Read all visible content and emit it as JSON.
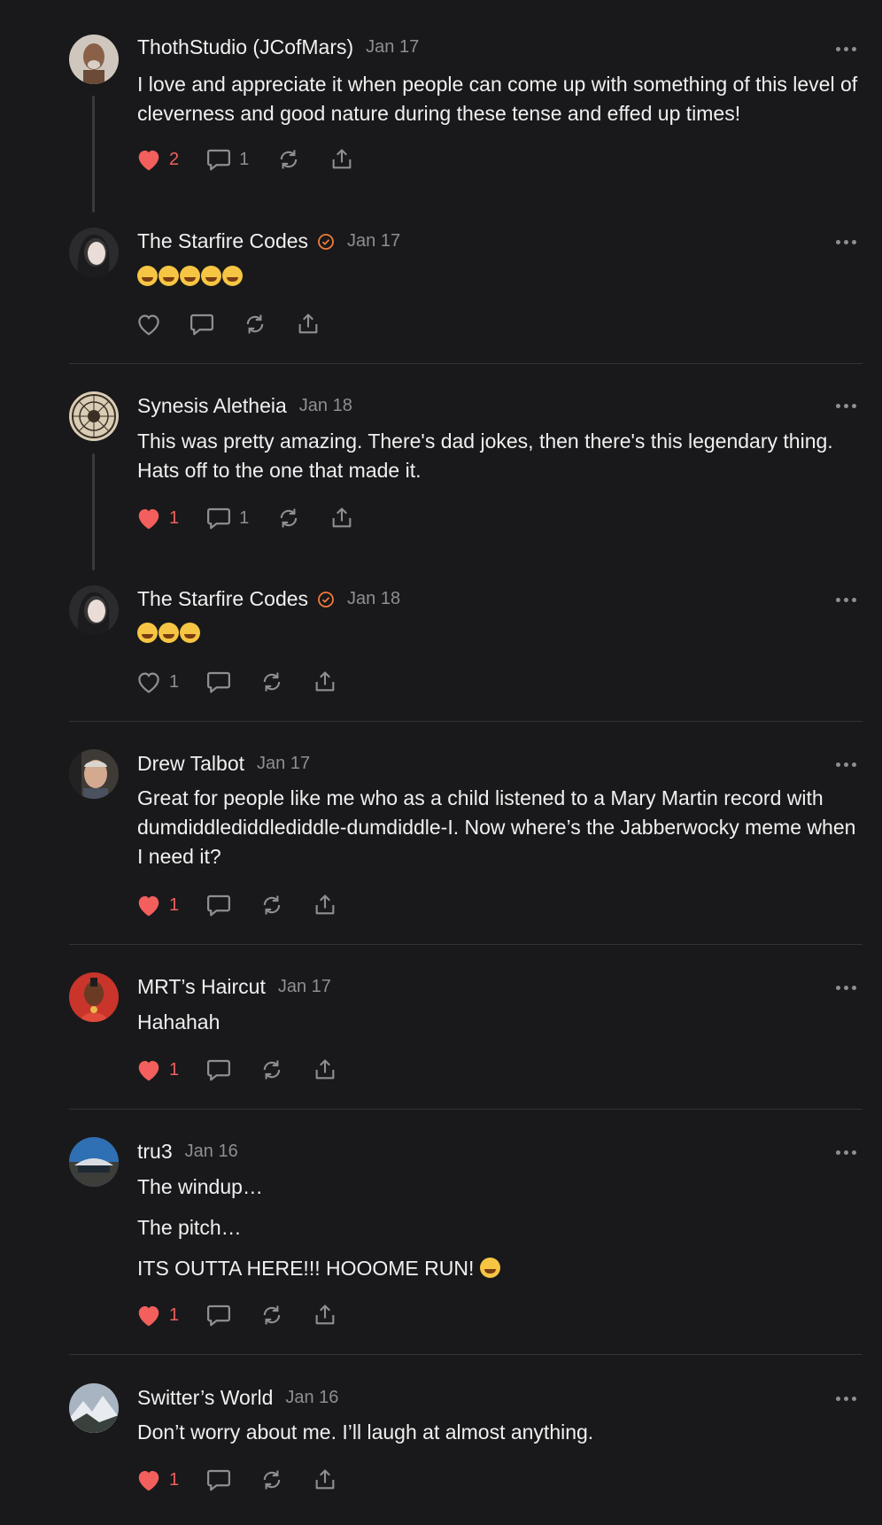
{
  "colors": {
    "background": "#19191b",
    "text": "#f0f0f0",
    "muted": "#8e8e93",
    "like": "#f25f5c",
    "verified": "#f07c3a",
    "divider": "#333336"
  },
  "comments": [
    {
      "author": "ThothStudio (JCofMars)",
      "date": "Jan 17",
      "text": [
        "I love and appreciate it when people can come up with something of this level of cleverness and good nature during these tense and effed up times!"
      ],
      "likes": "2",
      "replies": "1",
      "liked": true
    },
    {
      "author": "The Starfire Codes",
      "verified": true,
      "date": "Jan 17",
      "emoji_count": 5,
      "emoji_name": "rolling-on-floor-laughing",
      "likes": "",
      "replies": "",
      "liked": false
    },
    {
      "author": "Synesis Aletheia",
      "date": "Jan 18",
      "text": [
        "This was pretty amazing. There's dad jokes, then there's this legendary thing. Hats off to the one that made it."
      ],
      "likes": "1",
      "replies": "1",
      "liked": true
    },
    {
      "author": "The Starfire Codes",
      "verified": true,
      "date": "Jan 18",
      "emoji_count": 3,
      "emoji_name": "rolling-on-floor-laughing",
      "likes": "1",
      "replies": "",
      "liked": false
    },
    {
      "author": "Drew Talbot",
      "date": "Jan 17",
      "text": [
        "Great for people like me who as a child listened to a Mary Martin record with dumdiddlediddlediddle-dumdiddle-I. Now where’s the Jabberwocky meme when I need it?"
      ],
      "likes": "1",
      "replies": "",
      "liked": true
    },
    {
      "author": "MRT’s Haircut",
      "date": "Jan 17",
      "text": [
        "Hahahah"
      ],
      "likes": "1",
      "replies": "",
      "liked": true
    },
    {
      "author": "tru3",
      "date": "Jan 16",
      "text": [
        "The windup…",
        "The pitch…",
        "ITS OUTTA HERE!!! HOOOME RUN!"
      ],
      "trailing_emoji": "grinning-face",
      "likes": "1",
      "replies": "",
      "liked": true
    },
    {
      "author": "Switter’s World",
      "date": "Jan 16",
      "text": [
        "Don’t worry about me. I’ll laugh at almost anything."
      ],
      "likes": "1",
      "replies": "",
      "liked": true
    }
  ]
}
